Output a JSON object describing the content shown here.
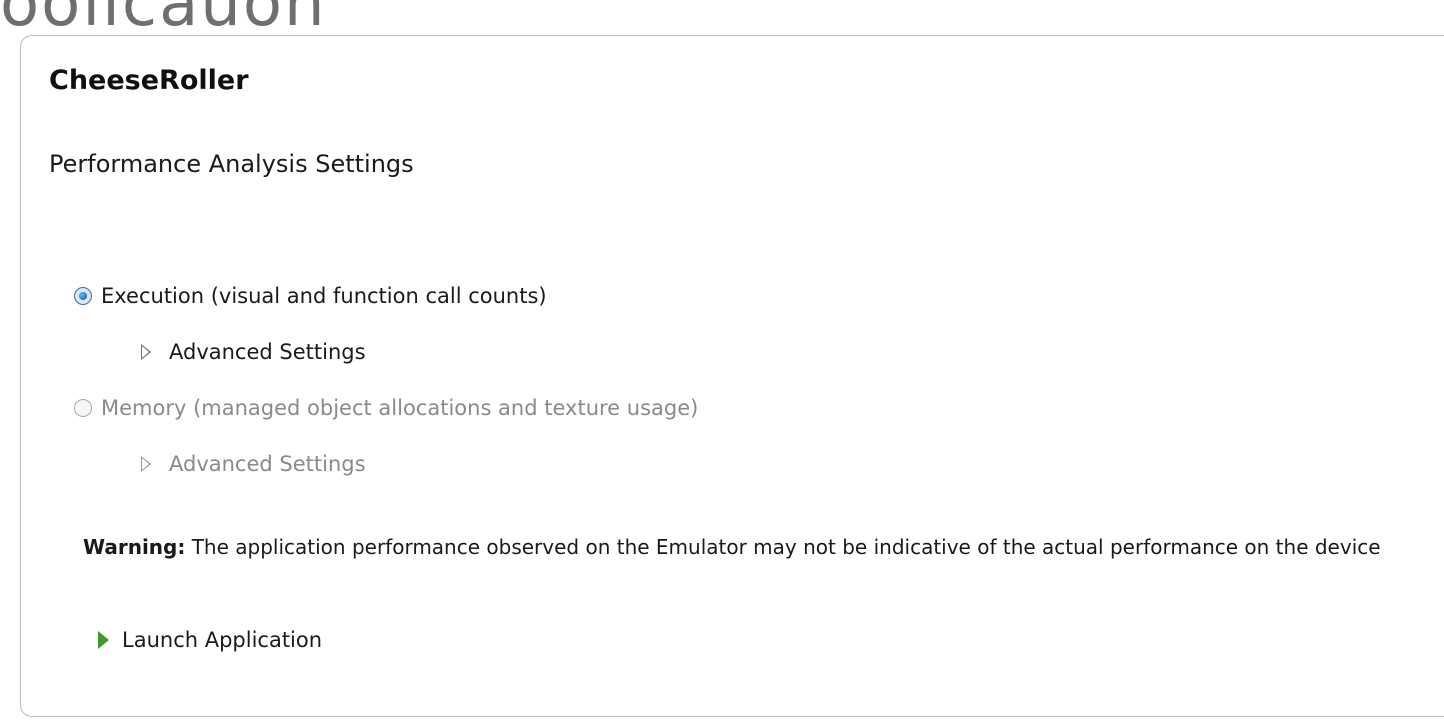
{
  "window": {
    "clipped_title_fragment": "oolicauon"
  },
  "app": {
    "title": "CheeseRoller"
  },
  "settings": {
    "section_title": "Performance Analysis Settings",
    "options": [
      {
        "label": "Execution (visual and function call counts)",
        "selected": true,
        "enabled": true,
        "advanced_label": "Advanced Settings"
      },
      {
        "label": "Memory (managed object allocations and texture usage)",
        "selected": false,
        "enabled": false,
        "advanced_label": "Advanced Settings"
      }
    ]
  },
  "warning": {
    "label": "Warning:",
    "text": " The application performance observed on the Emulator may not be indicative of the actual performance on the device"
  },
  "actions": {
    "launch_label": "Launch Application"
  },
  "icons": {
    "selected_radio": "radio-selected-icon",
    "unselected_radio": "radio-unselected-icon",
    "expander": "expander-triangle-icon",
    "launch": "play-icon"
  },
  "colors": {
    "launch_icon": "#3e9b2c",
    "disabled_text": "#8a8a8a",
    "panel_border": "#bdbdbd"
  }
}
